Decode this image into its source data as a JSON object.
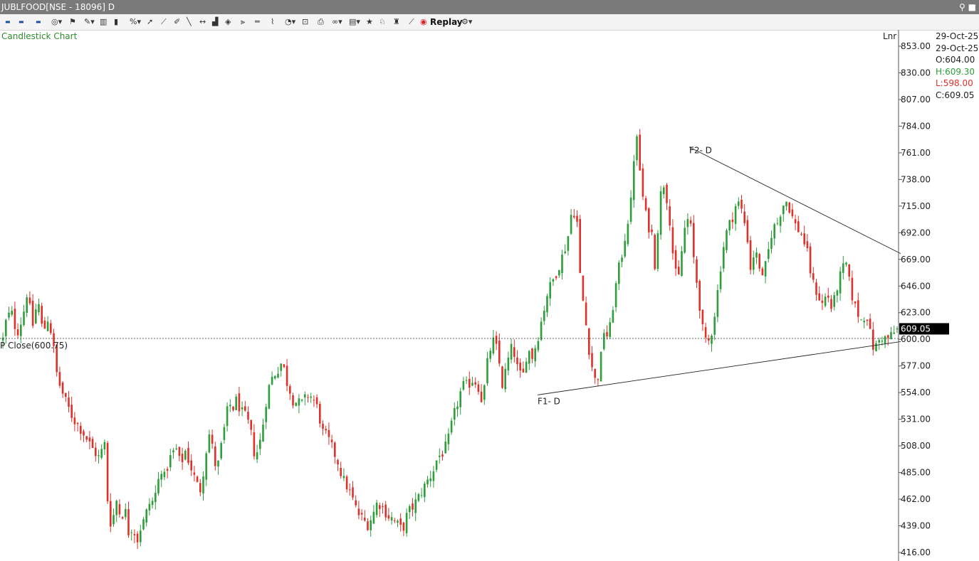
{
  "window": {
    "title": "JUBLFOOD[NSE - 18096] D"
  },
  "toolbar": {
    "replay_label": "Replay"
  },
  "chart_label": "Candlestick Chart",
  "scale_mode": "Lnr",
  "ohlc": {
    "date1": "29-Oct-25",
    "date2": "29-Oct-25",
    "open": "O:604.00",
    "high": "H:609.30",
    "low": "L:598.00",
    "close": "C:609.05"
  },
  "colors": {
    "up": "#2e9e3a",
    "down": "#e0302a",
    "label": "#2e8b2e",
    "titlebar": "#7a7a7a"
  },
  "chart_data": {
    "type": "candlestick",
    "y_ticks": [
      "853.00",
      "830.00",
      "807.00",
      "784.00",
      "761.00",
      "738.00",
      "715.00",
      "692.00",
      "669.00",
      "646.00",
      "623.00",
      "600.00",
      "577.00",
      "554.00",
      "531.00",
      "508.00",
      "485.00",
      "462.00",
      "439.00",
      "416.00"
    ],
    "ylim": [
      416,
      853
    ],
    "last_price": 609.05,
    "last_price_label": "609.05",
    "prev_close": 600.75,
    "prev_close_label": "P Close(600.75)",
    "n_bars": 300,
    "path_anchors": [
      [
        0,
        600
      ],
      [
        3,
        615
      ],
      [
        8,
        625
      ],
      [
        14,
        605
      ],
      [
        20,
        620
      ],
      [
        24,
        640
      ],
      [
        30,
        612
      ],
      [
        35,
        635
      ],
      [
        40,
        605
      ],
      [
        45,
        618
      ],
      [
        50,
        600
      ],
      [
        52,
        580
      ],
      [
        55,
        565
      ],
      [
        62,
        548
      ],
      [
        70,
        532
      ],
      [
        80,
        520
      ],
      [
        90,
        505
      ],
      [
        96,
        498
      ],
      [
        102,
        510
      ],
      [
        104,
        475
      ],
      [
        106,
        440
      ],
      [
        110,
        445
      ],
      [
        114,
        462
      ],
      [
        118,
        445
      ],
      [
        122,
        455
      ],
      [
        126,
        432
      ],
      [
        130,
        440
      ],
      [
        134,
        425
      ],
      [
        138,
        438
      ],
      [
        142,
        445
      ],
      [
        146,
        458
      ],
      [
        150,
        460
      ],
      [
        154,
        470
      ],
      [
        158,
        490
      ],
      [
        162,
        480
      ],
      [
        166,
        495
      ],
      [
        170,
        502
      ],
      [
        174,
        505
      ],
      [
        178,
        490
      ],
      [
        182,
        505
      ],
      [
        186,
        495
      ],
      [
        190,
        485
      ],
      [
        194,
        475
      ],
      [
        198,
        470
      ],
      [
        202,
        495
      ],
      [
        206,
        520
      ],
      [
        210,
        505
      ],
      [
        214,
        485
      ],
      [
        218,
        505
      ],
      [
        222,
        525
      ],
      [
        226,
        545
      ],
      [
        230,
        540
      ],
      [
        234,
        548
      ],
      [
        238,
        538
      ],
      [
        244,
        532
      ],
      [
        248,
        520
      ],
      [
        252,
        500
      ],
      [
        256,
        505
      ],
      [
        260,
        525
      ],
      [
        264,
        550
      ],
      [
        268,
        565
      ],
      [
        272,
        570
      ],
      [
        276,
        575
      ],
      [
        280,
        582
      ],
      [
        283,
        565
      ],
      [
        286,
        560
      ],
      [
        290,
        548
      ],
      [
        295,
        545
      ],
      [
        300,
        545
      ],
      [
        305,
        552
      ],
      [
        310,
        550
      ],
      [
        315,
        540
      ],
      [
        320,
        520
      ],
      [
        325,
        515
      ],
      [
        330,
        505
      ],
      [
        335,
        495
      ],
      [
        340,
        480
      ],
      [
        345,
        472
      ],
      [
        350,
        462
      ],
      [
        355,
        450
      ],
      [
        360,
        445
      ],
      [
        365,
        440
      ],
      [
        370,
        448
      ],
      [
        375,
        460
      ],
      [
        380,
        455
      ],
      [
        385,
        448
      ],
      [
        390,
        445
      ],
      [
        395,
        440
      ],
      [
        400,
        435
      ],
      [
        405,
        450
      ],
      [
        410,
        455
      ],
      [
        415,
        462
      ],
      [
        420,
        470
      ],
      [
        425,
        478
      ],
      [
        430,
        485
      ],
      [
        435,
        498
      ],
      [
        440,
        502
      ],
      [
        445,
        510
      ],
      [
        450,
        530
      ],
      [
        455,
        545
      ],
      [
        460,
        560
      ],
      [
        465,
        560
      ],
      [
        470,
        565
      ],
      [
        475,
        562
      ],
      [
        480,
        545
      ],
      [
        485,
        580
      ],
      [
        490,
        600
      ],
      [
        495,
        590
      ],
      [
        500,
        560
      ],
      [
        505,
        580
      ],
      [
        510,
        595
      ],
      [
        515,
        575
      ],
      [
        520,
        565
      ],
      [
        525,
        592
      ],
      [
        530,
        585
      ],
      [
        535,
        600
      ],
      [
        540,
        620
      ],
      [
        545,
        640
      ],
      [
        550,
        650
      ],
      [
        555,
        660
      ],
      [
        560,
        672
      ],
      [
        565,
        685
      ],
      [
        570,
        715
      ],
      [
        575,
        700
      ],
      [
        578,
        650
      ],
      [
        582,
        625
      ],
      [
        586,
        595
      ],
      [
        590,
        575
      ],
      [
        594,
        560
      ],
      [
        598,
        580
      ],
      [
        602,
        610
      ],
      [
        606,
        600
      ],
      [
        610,
        625
      ],
      [
        615,
        655
      ],
      [
        620,
        675
      ],
      [
        625,
        700
      ],
      [
        630,
        725
      ],
      [
        633,
        785
      ],
      [
        636,
        760
      ],
      [
        640,
        725
      ],
      [
        645,
        700
      ],
      [
        650,
        690
      ],
      [
        652,
        660
      ],
      [
        656,
        700
      ],
      [
        660,
        740
      ],
      [
        664,
        725
      ],
      [
        668,
        700
      ],
      [
        672,
        660
      ],
      [
        676,
        650
      ],
      [
        680,
        680
      ],
      [
        684,
        705
      ],
      [
        688,
        700
      ],
      [
        692,
        665
      ],
      [
        696,
        640
      ],
      [
        700,
        610
      ],
      [
        704,
        595
      ],
      [
        708,
        600
      ],
      [
        712,
        620
      ],
      [
        716,
        645
      ],
      [
        720,
        675
      ],
      [
        725,
        695
      ],
      [
        730,
        705
      ],
      [
        735,
        720
      ],
      [
        740,
        710
      ],
      [
        745,
        690
      ],
      [
        748,
        660
      ],
      [
        752,
        675
      ],
      [
        756,
        670
      ],
      [
        760,
        650
      ],
      [
        765,
        670
      ],
      [
        770,
        695
      ],
      [
        775,
        700
      ],
      [
        780,
        715
      ],
      [
        784,
        720
      ],
      [
        788,
        712
      ],
      [
        792,
        700
      ],
      [
        796,
        695
      ],
      [
        800,
        690
      ],
      [
        805,
        675
      ],
      [
        810,
        650
      ],
      [
        815,
        640
      ],
      [
        820,
        630
      ],
      [
        825,
        640
      ],
      [
        830,
        625
      ],
      [
        835,
        645
      ],
      [
        840,
        660
      ],
      [
        844,
        665
      ],
      [
        848,
        645
      ],
      [
        852,
        630
      ],
      [
        856,
        622
      ],
      [
        860,
        615
      ],
      [
        864,
        625
      ],
      [
        868,
        605
      ],
      [
        872,
        590
      ],
      [
        876,
        598
      ],
      [
        880,
        602
      ],
      [
        885,
        600
      ],
      [
        890,
        604
      ],
      [
        895,
        608
      ]
    ],
    "trendlines": [
      {
        "label": "F1- D",
        "x1": 755,
        "y1": 552,
        "x2": 1265,
        "y2": 598
      },
      {
        "label": "F2- D",
        "x1": 968,
        "y1": 766,
        "x2": 1265,
        "y2": 674
      }
    ]
  }
}
